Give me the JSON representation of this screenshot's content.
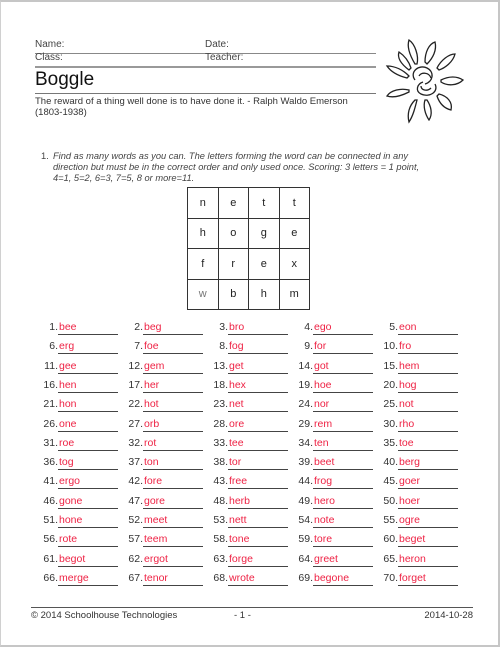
{
  "header": {
    "name_label": "Name:",
    "date_label": "Date:",
    "class_label": "Class:",
    "teacher_label": "Teacher:"
  },
  "title": "Boggle",
  "quote_line1": "The reward of a thing well done is to have done it. - Ralph Waldo Emerson",
  "quote_line2": "(1803-1938)",
  "logo_icon": "sun-icon",
  "instructions": {
    "number": "1.",
    "text": "Find as many words as you can. The letters forming the word can be connected in any direction but must be in the correct order and only used once. Scoring: 3 letters = 1 point, 4=1, 5=2, 6=3, 7=5, 8 or more=11."
  },
  "board": [
    [
      "n",
      "e",
      "t",
      "t"
    ],
    [
      "h",
      "o",
      "g",
      "e"
    ],
    [
      "f",
      "r",
      "e",
      "x"
    ],
    [
      "w",
      "b",
      "h",
      "m"
    ]
  ],
  "answers": [
    {
      "n": "1.",
      "w": "bee"
    },
    {
      "n": "2.",
      "w": "beg"
    },
    {
      "n": "3.",
      "w": "bro"
    },
    {
      "n": "4.",
      "w": "ego"
    },
    {
      "n": "5.",
      "w": "eon"
    },
    {
      "n": "6.",
      "w": "erg"
    },
    {
      "n": "7.",
      "w": "foe"
    },
    {
      "n": "8.",
      "w": "fog"
    },
    {
      "n": "9.",
      "w": "for"
    },
    {
      "n": "10.",
      "w": "fro"
    },
    {
      "n": "11.",
      "w": "gee"
    },
    {
      "n": "12.",
      "w": "gem"
    },
    {
      "n": "13.",
      "w": "get"
    },
    {
      "n": "14.",
      "w": "got"
    },
    {
      "n": "15.",
      "w": "hem"
    },
    {
      "n": "16.",
      "w": "hen"
    },
    {
      "n": "17.",
      "w": "her"
    },
    {
      "n": "18.",
      "w": "hex"
    },
    {
      "n": "19.",
      "w": "hoe"
    },
    {
      "n": "20.",
      "w": "hog"
    },
    {
      "n": "21.",
      "w": "hon"
    },
    {
      "n": "22.",
      "w": "hot"
    },
    {
      "n": "23.",
      "w": "net"
    },
    {
      "n": "24.",
      "w": "nor"
    },
    {
      "n": "25.",
      "w": "not"
    },
    {
      "n": "26.",
      "w": "one"
    },
    {
      "n": "27.",
      "w": "orb"
    },
    {
      "n": "28.",
      "w": "ore"
    },
    {
      "n": "29.",
      "w": "rem"
    },
    {
      "n": "30.",
      "w": "rho"
    },
    {
      "n": "31.",
      "w": "roe"
    },
    {
      "n": "32.",
      "w": "rot"
    },
    {
      "n": "33.",
      "w": "tee"
    },
    {
      "n": "34.",
      "w": "ten"
    },
    {
      "n": "35.",
      "w": "toe"
    },
    {
      "n": "36.",
      "w": "tog"
    },
    {
      "n": "37.",
      "w": "ton"
    },
    {
      "n": "38.",
      "w": "tor"
    },
    {
      "n": "39.",
      "w": "beet"
    },
    {
      "n": "40.",
      "w": "berg"
    },
    {
      "n": "41.",
      "w": "ergo"
    },
    {
      "n": "42.",
      "w": "fore"
    },
    {
      "n": "43.",
      "w": "free"
    },
    {
      "n": "44.",
      "w": "frog"
    },
    {
      "n": "45.",
      "w": "goer"
    },
    {
      "n": "46.",
      "w": "gone"
    },
    {
      "n": "47.",
      "w": "gore"
    },
    {
      "n": "48.",
      "w": "herb"
    },
    {
      "n": "49.",
      "w": "hero"
    },
    {
      "n": "50.",
      "w": "hoer"
    },
    {
      "n": "51.",
      "w": "hone"
    },
    {
      "n": "52.",
      "w": "meet"
    },
    {
      "n": "53.",
      "w": "nett"
    },
    {
      "n": "54.",
      "w": "note"
    },
    {
      "n": "55.",
      "w": "ogre"
    },
    {
      "n": "56.",
      "w": "rote"
    },
    {
      "n": "57.",
      "w": "teem"
    },
    {
      "n": "58.",
      "w": "tone"
    },
    {
      "n": "59.",
      "w": "tore"
    },
    {
      "n": "60.",
      "w": "beget"
    },
    {
      "n": "61.",
      "w": "begot"
    },
    {
      "n": "62.",
      "w": "ergot"
    },
    {
      "n": "63.",
      "w": "forge"
    },
    {
      "n": "64.",
      "w": "greet"
    },
    {
      "n": "65.",
      "w": "heron"
    },
    {
      "n": "66.",
      "w": "merge"
    },
    {
      "n": "67.",
      "w": "tenor"
    },
    {
      "n": "68.",
      "w": "wrote"
    },
    {
      "n": "69.",
      "w": "begone"
    },
    {
      "n": "70.",
      "w": "forget"
    }
  ],
  "colors": {
    "answer_text": "#ee2244"
  },
  "footer": {
    "copyright": "© 2014 Schoolhouse Technologies",
    "page": "- 1 -",
    "date": "2014-10-28"
  }
}
